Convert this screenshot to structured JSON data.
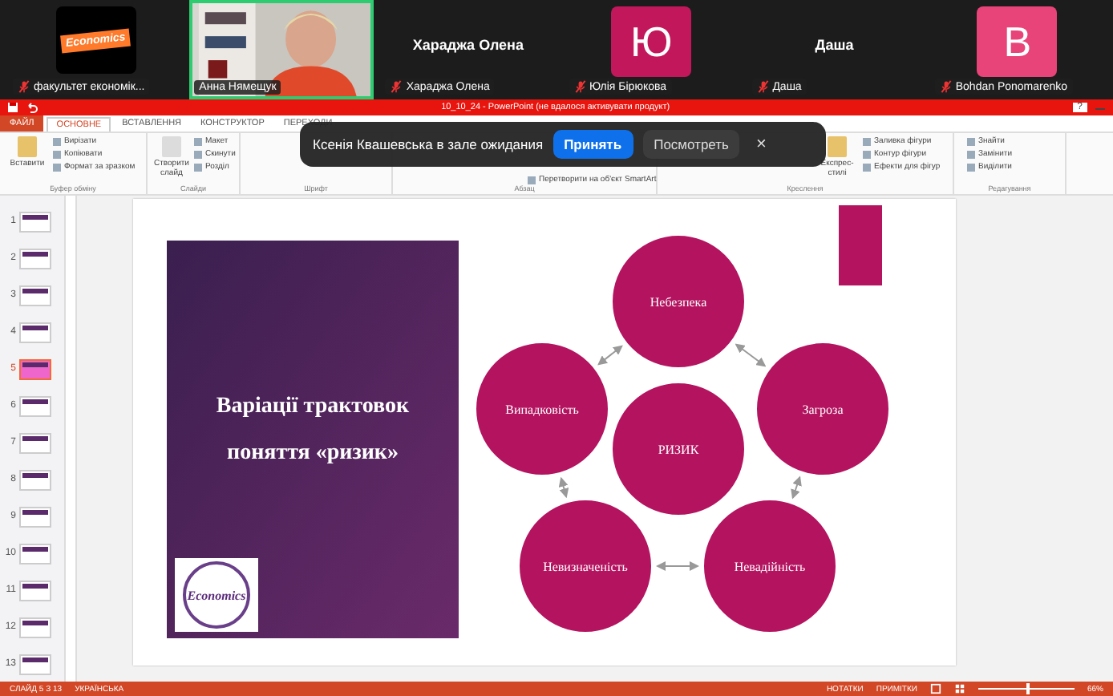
{
  "participants": [
    {
      "kind": "logo",
      "logo_text": "Economics",
      "name": "факультет  економік...",
      "muted": true,
      "speaking": false
    },
    {
      "kind": "video",
      "name": "Анна Нямещук",
      "muted": false,
      "speaking": true
    },
    {
      "kind": "name",
      "display": "Хараджа Олена",
      "name": "Хараджа Олена",
      "muted": true,
      "speaking": false
    },
    {
      "kind": "initial",
      "initial": "Ю",
      "color": "#c2185b",
      "name": "Юлія Бірюкова",
      "muted": true,
      "speaking": false
    },
    {
      "kind": "name",
      "display": "Даша",
      "name": "Даша",
      "muted": true,
      "speaking": false
    },
    {
      "kind": "initial",
      "initial": "B",
      "color": "#e8447a",
      "name": "Bohdan Ponomarenko",
      "muted": true,
      "speaking": false
    }
  ],
  "app": {
    "title": "10_10_24 - PowerPoint (не вдалося активувати продукт)",
    "help": "?"
  },
  "tabs": [
    {
      "label": "ФАЙЛ",
      "kind": "file",
      "selected": false
    },
    {
      "label": "ОСНОВНЕ",
      "kind": "tab",
      "selected": true
    },
    {
      "label": "ВСТАВЛЕННЯ",
      "kind": "tab",
      "selected": false
    },
    {
      "label": "КОНСТРУКТОР",
      "kind": "tab",
      "selected": false
    },
    {
      "label": "ПЕРЕХОДИ",
      "kind": "tab",
      "selected": false
    }
  ],
  "ribbon": [
    {
      "label": "Буфер обміну",
      "big": "Вставити",
      "items": [
        "Вирізати",
        "Копіювати",
        "Формат за зразком"
      ]
    },
    {
      "label": "Слайди",
      "big": "Створити слайд",
      "items": [
        "Макет",
        "Скинути",
        "Розділ"
      ]
    },
    {
      "label": "Шрифт"
    },
    {
      "label": "Абзац",
      "items": [
        "Перетворити на об'єкт SmartArt"
      ]
    },
    {
      "label": "Креслення",
      "big": "Експрес-стилі",
      "items": [
        "Заливка фігури",
        "Контур фігури",
        "Ефекти для фігур"
      ]
    },
    {
      "label": "Редагування",
      "items": [
        "Знайти",
        "Замінити",
        "Виділити"
      ]
    }
  ],
  "toast": {
    "message": "Ксенія Квашевська в зале ожидания",
    "accept": "Принять",
    "view": "Посмотреть",
    "close": "×"
  },
  "thumbnails": [
    {
      "number": "1",
      "selected": false
    },
    {
      "number": "2",
      "selected": false
    },
    {
      "number": "3",
      "selected": false
    },
    {
      "number": "4",
      "selected": false
    },
    {
      "number": "5",
      "selected": true
    },
    {
      "number": "6",
      "selected": false
    },
    {
      "number": "7",
      "selected": false
    },
    {
      "number": "8",
      "selected": false
    },
    {
      "number": "9",
      "selected": false
    },
    {
      "number": "10",
      "selected": false
    },
    {
      "number": "11",
      "selected": false
    },
    {
      "number": "12",
      "selected": false
    },
    {
      "number": "13",
      "selected": false
    }
  ],
  "slide": {
    "title_lines": [
      "Варіації трактовок",
      "поняття «ризик»"
    ],
    "logo_text": "Economics",
    "center": "РИЗИК",
    "nodes": [
      "Небезпека",
      "Загроза",
      "Невадійність",
      "Невизначеність",
      "Випадковість"
    ]
  },
  "status_bar": {
    "slide": "СЛАЙД 5 З 13",
    "language": "УКРАЇНСЬКА",
    "notes": "НОТАТКИ",
    "comments": "ПРИМІТКИ",
    "zoom": "66%",
    "level": 0.5
  }
}
